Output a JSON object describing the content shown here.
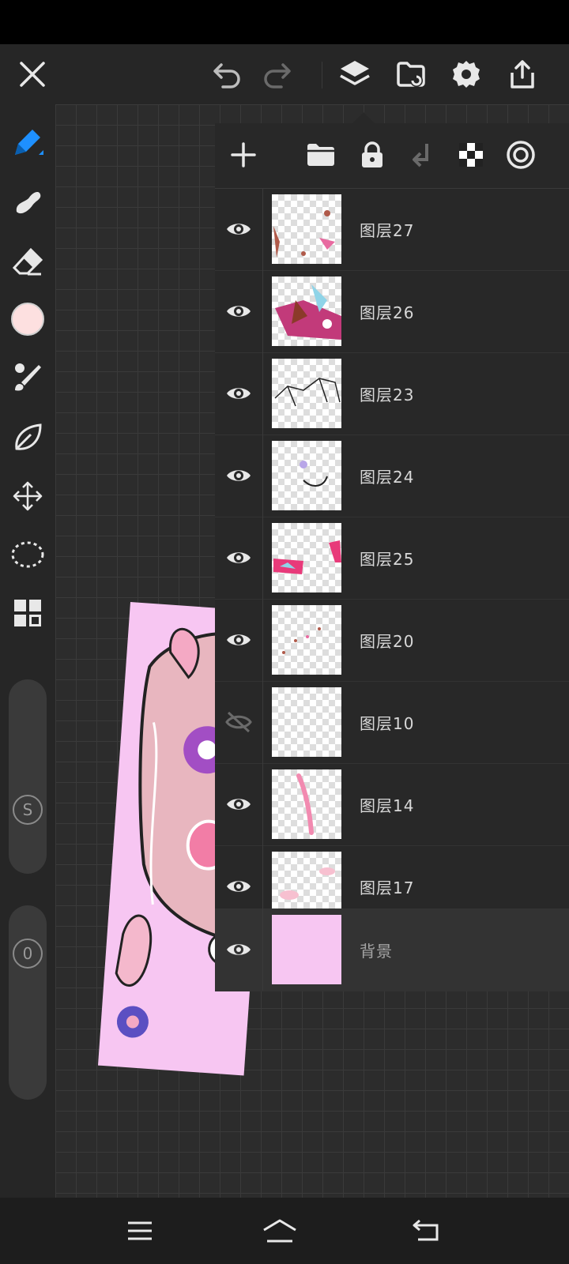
{
  "toolbar": {
    "icons": [
      "close-icon",
      "undo-icon",
      "redo-icon",
      "layers-icon",
      "gallery-icon",
      "settings-icon",
      "share-icon"
    ]
  },
  "tools": [
    "pen-icon",
    "smudge-icon",
    "eraser-icon",
    "color-swatch",
    "brush-library-icon",
    "leaf-icon",
    "transform-icon",
    "lasso-icon",
    "grid-icon"
  ],
  "colors": {
    "current": "#fde0e0",
    "accent": "#1e90ff",
    "artwork_bg": "#f7c6f2"
  },
  "sliders": {
    "size_label": "S",
    "opacity_label": "0"
  },
  "layers_panel": {
    "toolbar_icons": [
      "add-layer-icon",
      "folder-icon",
      "lock-icon",
      "merge-down-icon",
      "checker-icon",
      "target-icon"
    ],
    "layers": [
      {
        "name": "图层27",
        "visible": true
      },
      {
        "name": "图层26",
        "visible": true
      },
      {
        "name": "图层23",
        "visible": true
      },
      {
        "name": "图层24",
        "visible": true
      },
      {
        "name": "图层25",
        "visible": true
      },
      {
        "name": "图层20",
        "visible": true
      },
      {
        "name": "图层10",
        "visible": false
      },
      {
        "name": "图层14",
        "visible": true
      },
      {
        "name": "图层17",
        "visible": true
      },
      {
        "name": "背景",
        "visible": true,
        "selected": true
      }
    ]
  },
  "navbar": {
    "icons": [
      "menu-icon",
      "home-icon",
      "back-icon"
    ]
  }
}
